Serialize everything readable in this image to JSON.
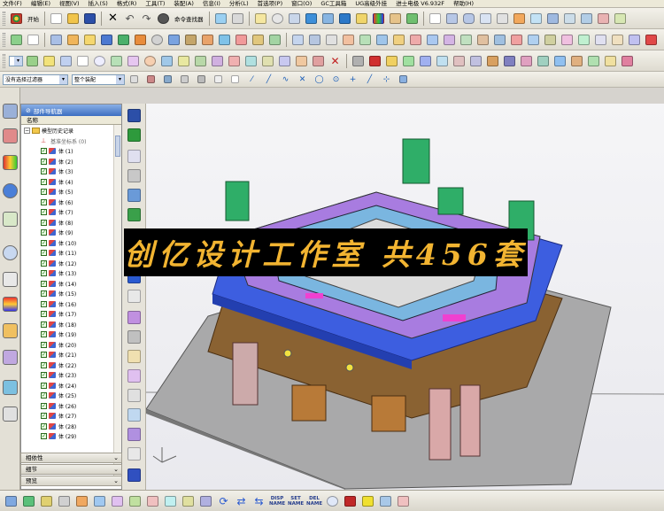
{
  "menu": [
    "文件(F)",
    "编辑(E)",
    "视图(V)",
    "插入(S)",
    "格式(R)",
    "工具(T)",
    "装配(A)",
    "信息(I)",
    "分析(L)",
    "首选项(P)",
    "窗口(O)",
    "GC工具箱",
    "UG高级外挂",
    "进士电极 V6.932F",
    "帮助(H)"
  ],
  "toolbar": {
    "start_label": "开始",
    "command_finder_label": "命令查找器"
  },
  "selection_bar": {
    "filter_value": "没有选择过滤器",
    "scope_value": "整个装配"
  },
  "navigator": {
    "title": "部件导航器",
    "column_name": "名称",
    "history_label": "模型历史记录",
    "datum_label": "基准坐标系 (0)",
    "bodies": [
      "体 (1)",
      "体 (2)",
      "体 (3)",
      "体 (4)",
      "体 (5)",
      "体 (6)",
      "体 (7)",
      "体 (8)",
      "体 (9)",
      "体 (10)",
      "体 (11)",
      "体 (12)",
      "体 (13)",
      "体 (14)",
      "体 (15)",
      "体 (16)",
      "体 (17)",
      "体 (18)",
      "体 (19)",
      "体 (20)",
      "体 (21)",
      "体 (22)",
      "体 (23)",
      "体 (24)",
      "体 (25)",
      "体 (26)",
      "体 (27)",
      "体 (28)",
      "体 (29)"
    ]
  },
  "panels": {
    "dependencies": "相依性",
    "details": "细节",
    "preview": "预览"
  },
  "banner_text": "创亿设计工作室 共456套",
  "bottom_labels": {
    "disp_top": "DISP",
    "disp_bottom": "NAME",
    "set_top": "SET",
    "set_bottom": "NAME",
    "del_top": "DEL",
    "del_bottom": "NAME"
  },
  "colors": {
    "banner_text": "#f2b431",
    "navigator_header": "#3c6fc1",
    "mold_plate_blue": "#3d5ee0",
    "mold_base_brown": "#8a6232"
  }
}
